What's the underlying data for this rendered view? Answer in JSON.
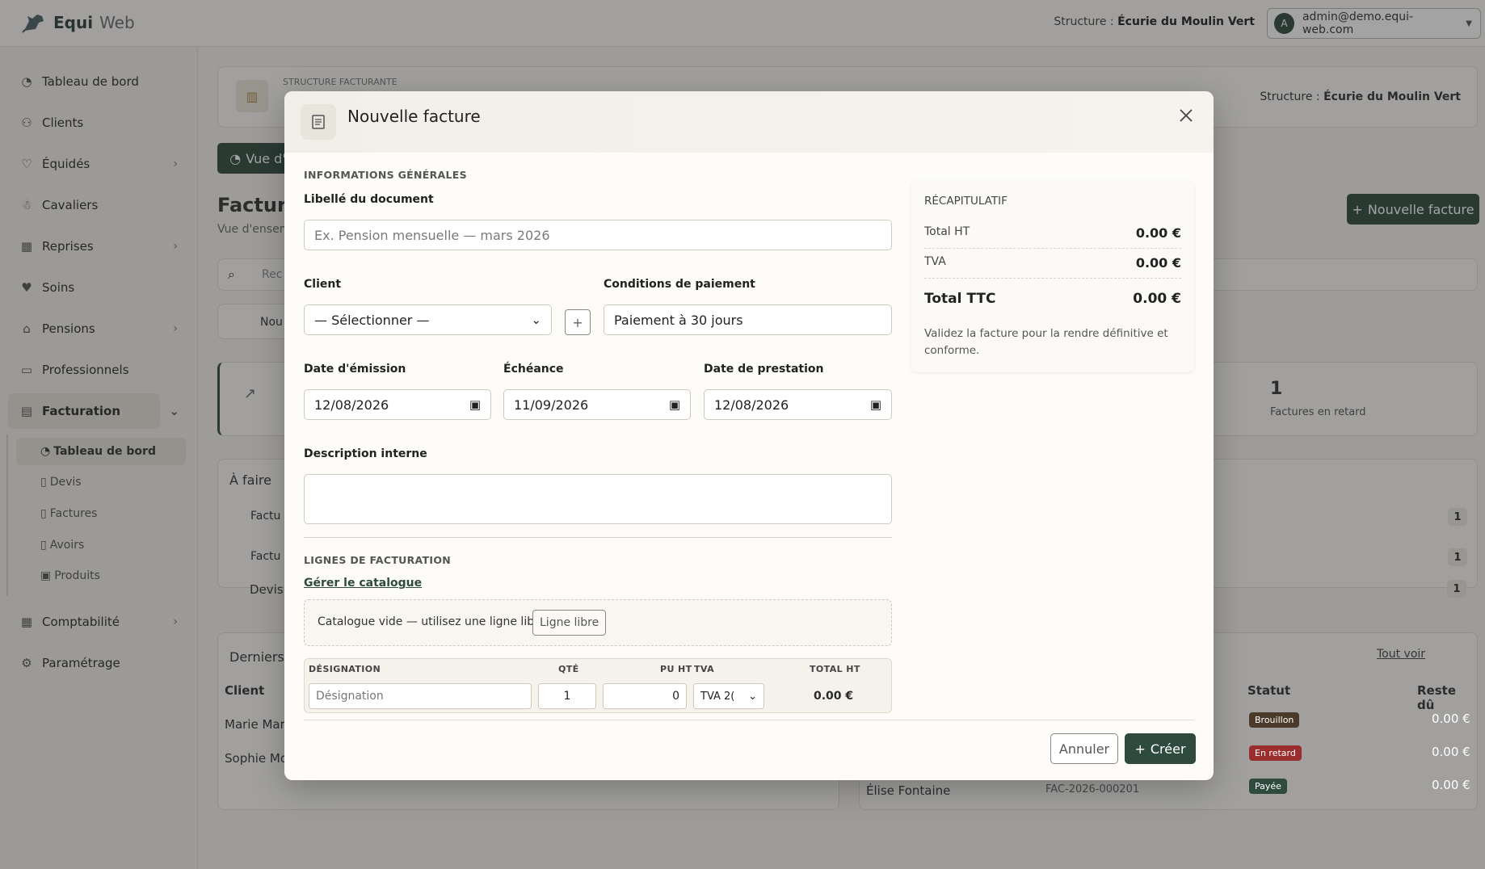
{
  "app": {
    "brand_bold": "Equi",
    "brand_light": "Web"
  },
  "header": {
    "structure_prefix": "Structure : ",
    "structure_name": "Écurie du Moulin Vert",
    "user_initial": "A",
    "user_email": "admin@demo.equi-web.com"
  },
  "sidebar": {
    "items": [
      {
        "label": "Tableau de bord",
        "icon": "gauge-icon"
      },
      {
        "label": "Clients",
        "icon": "users-icon"
      },
      {
        "label": "Équidés",
        "icon": "heart-pulse-icon"
      },
      {
        "label": "Cavaliers",
        "icon": "rider-icon"
      },
      {
        "label": "Reprises",
        "icon": "calendar-icon"
      },
      {
        "label": "Soins",
        "icon": "heart-icon"
      },
      {
        "label": "Pensions",
        "icon": "home-icon"
      },
      {
        "label": "Professionnels",
        "icon": "briefcase-icon"
      },
      {
        "label": "Facturation",
        "icon": "receipt-icon"
      },
      {
        "label": "Comptabilité",
        "icon": "calculator-icon"
      },
      {
        "label": "Paramétrage",
        "icon": "gear-icon"
      }
    ],
    "sub_items": [
      {
        "label": "Tableau de bord"
      },
      {
        "label": "Devis"
      },
      {
        "label": "Factures"
      },
      {
        "label": "Avoirs"
      },
      {
        "label": "Produits"
      }
    ]
  },
  "background": {
    "structure_heading": "STRUCTURE FACTURANTE",
    "structure_prefix": "Structure : ",
    "structure_name": "Écurie du Moulin Vert",
    "vue_button": "Vue d'",
    "page_title": "Factura",
    "page_subtitle": "Vue d'ensem",
    "search_placeholder": "Rec",
    "new_invoice_button": "Nouvelle facture",
    "nou_label": "Nou",
    "stat_value": "1",
    "stat_label": "Factures en retard",
    "todo_title": "À faire",
    "todo_rows": [
      {
        "label": "Factu",
        "count": "1"
      },
      {
        "label": "Factu",
        "count": "1"
      },
      {
        "label": "Devis",
        "count": "1"
      }
    ],
    "recent_title": "Derniers",
    "see_all": "Tout voir",
    "col_client": "Client",
    "col_status": "Statut",
    "col_due": "Reste dû",
    "rows": [
      {
        "client": "Marie Mar",
        "status": "Brouillon",
        "status_color": "#4b3a2a",
        "due": "0.00 €"
      },
      {
        "client": "Sophie Mo",
        "status": "En retard",
        "status_color": "#9a2e2e",
        "due": "0.00 €"
      },
      {
        "client": "Élise Fontaine",
        "ref": "FAC-2026-000201",
        "status": "Payée",
        "status_color": "#2f4a3e",
        "due": "0.00 €"
      }
    ]
  },
  "modal": {
    "title": "Nouvelle facture",
    "general_section": "INFORMATIONS GÉNÉRALES",
    "doc_label": "Libellé du document",
    "doc_placeholder": "Ex. Pension mensuelle — mars 2026",
    "client_label": "Client",
    "client_value": "— Sélectionner —",
    "payment_label": "Conditions de paiement",
    "payment_value": "Paiement à 30 jours",
    "issue_date_label": "Date d'émission",
    "issue_date_value": "12/08/2026",
    "due_date_label": "Échéance",
    "due_date_value": "11/09/2026",
    "service_date_label": "Date de prestation",
    "service_date_value": "12/08/2026",
    "description_label": "Description interne",
    "lines_section": "LIGNES DE FACTURATION",
    "manage_catalogue": "Gérer le catalogue",
    "catalogue_empty": "Catalogue vide — utilisez une ligne libre.",
    "free_line_button": "Ligne libre",
    "table": {
      "col_designation": "DÉSIGNATION",
      "col_qty": "QTÉ",
      "col_unit_price": "PU HT",
      "col_vat": "TVA",
      "col_total": "TOTAL HT",
      "designation_placeholder": "Désignation",
      "qty_value": "1",
      "unit_price_value": "0",
      "vat_value": "TVA 2(",
      "total_value": "0.00 €"
    },
    "recap": {
      "title": "RÉCAPITULATIF",
      "total_ht_label": "Total HT",
      "total_ht_value": "0.00 €",
      "tva_label": "TVA",
      "tva_value": "0.00 €",
      "total_ttc_label": "Total TTC",
      "total_ttc_value": "0.00 €",
      "note": "Validez la facture pour la rendre définitive et conforme."
    },
    "cancel_button": "Annuler",
    "create_button": "Créer"
  }
}
